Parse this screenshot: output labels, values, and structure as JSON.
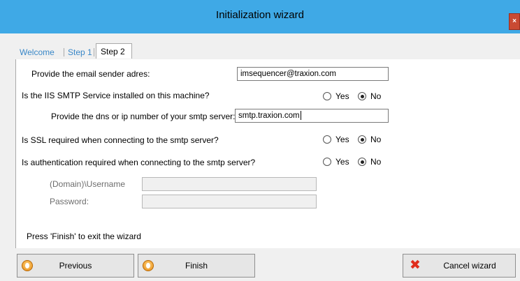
{
  "window": {
    "title": "Initialization wizard",
    "close_glyph": "×"
  },
  "tabs": [
    {
      "label": "Welcome",
      "active": false
    },
    {
      "label": "Step 1",
      "active": false
    },
    {
      "label": "Step 2",
      "active": true
    }
  ],
  "form": {
    "sender_label": "Provide the email sender adres:",
    "sender_value": "imsequencer@traxion.com",
    "iis_question": "Is the IIS SMTP Service installed on this machine?",
    "iis_yes": "Yes",
    "iis_no": "No",
    "iis_selected": "No",
    "smtp_label": "Provide the dns or ip number of your smtp server:",
    "smtp_value": "smtp.traxion.com",
    "ssl_question": "Is SSL required when connecting to the smtp server?",
    "ssl_yes": "Yes",
    "ssl_no": "No",
    "ssl_selected": "No",
    "auth_question": "Is authentication required when connecting to the smtp server?",
    "auth_yes": "Yes",
    "auth_no": "No",
    "auth_selected": "No",
    "username_label": "(Domain)\\Username",
    "username_value": "",
    "password_label": "Password:",
    "password_value": "",
    "finish_hint": "Press 'Finish' to exit the wizard"
  },
  "buttons": {
    "previous": "Previous",
    "finish": "Finish",
    "cancel": "Cancel wizard"
  },
  "icons": {
    "previous": "orange-circle-icon",
    "finish": "orange-circle-icon",
    "cancel": "red-x-icon"
  }
}
